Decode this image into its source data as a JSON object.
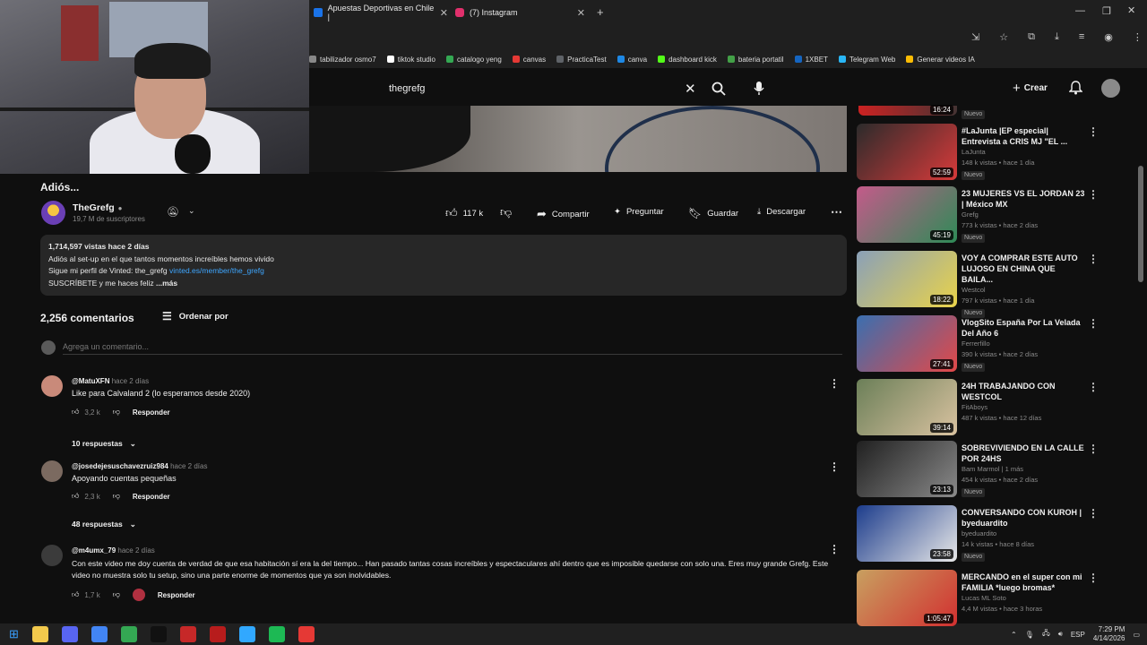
{
  "browser": {
    "tabs": [
      {
        "label": "Apuestas Deportivas en Chile |",
        "color": "#1a73e8"
      },
      {
        "label": "(7) Instagram",
        "color": "#e1306c"
      }
    ],
    "new_tab": "+",
    "bookmarks": [
      {
        "label": "tabilizador osmo7",
        "color": "#888888"
      },
      {
        "label": "tiktok studio",
        "color": "#ffffff"
      },
      {
        "label": "catalogo yeng",
        "color": "#34a853"
      },
      {
        "label": "canvas",
        "color": "#e53935"
      },
      {
        "label": "PracticaTest",
        "color": "#5f6368"
      },
      {
        "label": "canva",
        "color": "#1e88e5"
      },
      {
        "label": "dashboard kick",
        "color": "#53fc18"
      },
      {
        "label": "bateria portatil",
        "color": "#43a047"
      },
      {
        "label": "1XBET",
        "color": "#1565c0"
      },
      {
        "label": "Telegram Web",
        "color": "#29b6f6"
      },
      {
        "label": "Generar videos IA",
        "color": "#fbbc04"
      }
    ]
  },
  "header": {
    "search_value": "thegrefg",
    "create_label": "Crear"
  },
  "video": {
    "title": "Adiós...",
    "channel": "TheGrefg",
    "subscribers": "19,7 M de suscriptores",
    "likes": "117 k",
    "actions": {
      "share": "Compartir",
      "ask": "Preguntar",
      "save": "Guardar",
      "download": "Descargar"
    },
    "description": {
      "stats": "1,714,597 vistas  hace 2 días",
      "line1": "Adiós al set-up en el que tantos momentos increíbles hemos vivido",
      "line2": "Sigue mi perfil de Vinted: the_grefg",
      "line2_link": "vinted.es/member/the_grefg",
      "line3": "SUSCRÍBETE y me haces feliz",
      "more": "...más"
    }
  },
  "comments": {
    "count_label": "2,256 comentarios",
    "sort_label": "Ordenar por",
    "add_placeholder": "Agrega un comentario...",
    "items": [
      {
        "author": "@MatuXFN",
        "time": "hace 2 días",
        "text": "Like para Calvaland 2 (lo esperamos desde 2020)",
        "likes": "3,2 k",
        "reply": "Responder",
        "replies": "10 respuestas",
        "avatar": "#c98a7a"
      },
      {
        "author": "@josedejesuschavezruiz984",
        "time": "hace 2 días",
        "text": "Apoyando cuentas pequeñas",
        "likes": "2,3 k",
        "reply": "Responder",
        "replies": "48 respuestas",
        "avatar": "#7b6a60"
      },
      {
        "author": "@m4umx_79",
        "time": "hace 2 días",
        "text": "Con este video me doy cuenta de verdad de que esa habitación sí era la del tiempo... Han pasado tantas cosas increíbles y espectaculares ahí dentro que es imposible quedarse con solo una. Eres muy grande Grefg. Este video no muestra solo tu setup, sino una parte enorme de momentos que ya son inolvidables.",
        "likes": "1,7 k",
        "reply": "Responder",
        "replies": "",
        "avatar": "#3b3b3b"
      }
    ]
  },
  "related": [
    {
      "title": "#LaJunta |EP especial| Entrevista a CRIS MJ \"EL ...",
      "channel": "LaJunta",
      "meta": "148 k vistas • hace 1 día",
      "badge": "Nuevo",
      "duration": "52:59",
      "colors": [
        "#2b2b2b",
        "#d83a3a"
      ]
    },
    {
      "title": "23 MUJERES VS EL JORDAN 23 | México MX",
      "channel": "Grefg",
      "meta": "773 k vistas • hace 2 días",
      "badge": "Nuevo",
      "duration": "45:19",
      "colors": [
        "#c45a8a",
        "#2e8b57"
      ]
    },
    {
      "title": "VOY A COMPRAR ESTE AUTO LUJOSO EN CHINA QUE BAILA...",
      "channel": "Westcol",
      "meta": "797 k vistas • hace 1 día",
      "badge": "Nuevo",
      "duration": "18:22",
      "colors": [
        "#8aa0b8",
        "#e9d34a"
      ]
    },
    {
      "title": "VlogSito España Por La Velada Del Año 6",
      "channel": "Ferrerfillo",
      "meta": "390 k vistas • hace 2 días",
      "badge": "Nuevo",
      "duration": "27:41",
      "colors": [
        "#3a6fb0",
        "#e34848"
      ]
    },
    {
      "title": "24H TRABAJANDO CON WESTCOL",
      "channel": "FitAboys",
      "meta": "487 k vistas • hace 12 días",
      "badge": "",
      "duration": "39:14",
      "colors": [
        "#6b7f58",
        "#d9c2a0"
      ]
    },
    {
      "title": "SOBREVIVIENDO EN LA CALLE POR 24HS",
      "channel": "Bam Marmol | 1 más",
      "meta": "454 k vistas • hace 2 días",
      "badge": "Nuevo",
      "duration": "23:13",
      "colors": [
        "#202020",
        "#8a8a8a"
      ]
    },
    {
      "title": "CONVERSANDO CON KUROH | byeduardito",
      "channel": "byeduardito",
      "meta": "14 k vistas • hace 8 días",
      "badge": "Nuevo",
      "duration": "23:58",
      "colors": [
        "#1c3c8c",
        "#e8e8e8"
      ]
    },
    {
      "title": "MERCANDO en el super con mi FAMILIA *luego bromas*",
      "channel": "Lucas ML Soto",
      "meta": "4,4 M vistas • hace 3 horas",
      "badge": "",
      "duration": "1:05:47",
      "colors": [
        "#c8a060",
        "#d23030"
      ]
    }
  ],
  "taskbar": {
    "time": "7:29 PM",
    "date": "4/14/2026",
    "lang": "ESP",
    "apps": [
      {
        "name": "file-explorer-icon",
        "color": "#f2c94c"
      },
      {
        "name": "discord-icon",
        "color": "#5865f2"
      },
      {
        "name": "chrome-icon",
        "color": "#4285f4"
      },
      {
        "name": "chrome-alt-icon",
        "color": "#34a853"
      },
      {
        "name": "capcut-icon",
        "color": "#111111"
      },
      {
        "name": "red-app-icon",
        "color": "#c62828"
      },
      {
        "name": "red-app-2-icon",
        "color": "#b71c1c"
      },
      {
        "name": "photoshop-icon",
        "color": "#31a8ff"
      },
      {
        "name": "spotify-icon",
        "color": "#1db954"
      },
      {
        "name": "obs-icon",
        "color": "#e53935"
      }
    ]
  }
}
